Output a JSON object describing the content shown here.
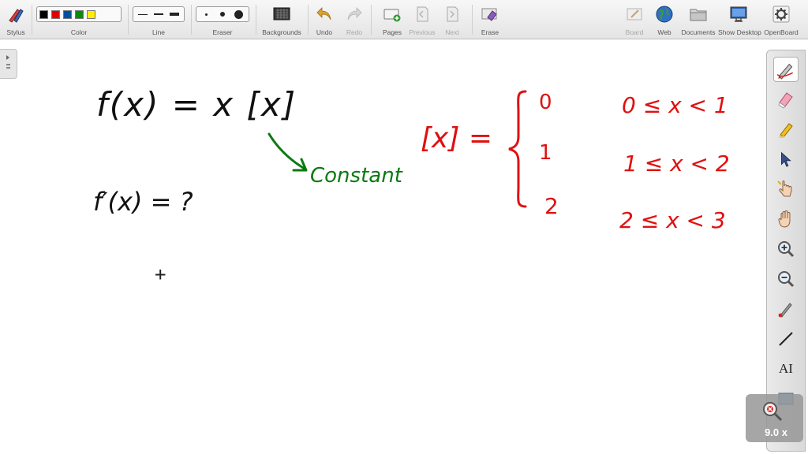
{
  "toolbar": {
    "stylus": "Stylus",
    "color": "Color",
    "line": "Line",
    "eraser": "Eraser",
    "backgrounds": "Backgrounds",
    "undo": "Undo",
    "redo": "Redo",
    "pages": "Pages",
    "previous": "Previous",
    "next": "Next",
    "erase": "Erase",
    "board": "Board",
    "web": "Web",
    "documents": "Documents",
    "show_desktop": "Show Desktop",
    "openboard": "OpenBoard"
  },
  "colors": {
    "palette": [
      "#000000",
      "#e00000",
      "#0050a0",
      "#0a8a0a",
      "#ffee00"
    ],
    "ink_black": "#111111",
    "ink_red": "#e01010",
    "ink_green": "#0a7a10"
  },
  "zoom": {
    "label": "9.0 x"
  },
  "board": {
    "function_def": "f(x) = x [x]",
    "derivative_question": "f′(x) = ?",
    "annotation": "Constant",
    "gif_lhs": "[x] =",
    "gif_values": [
      "0",
      "1",
      "2"
    ],
    "gif_ranges": [
      "0 ≤ x < 1",
      "1 ≤ x < 2",
      "2 ≤ x < 3"
    ],
    "cursor": "+"
  }
}
